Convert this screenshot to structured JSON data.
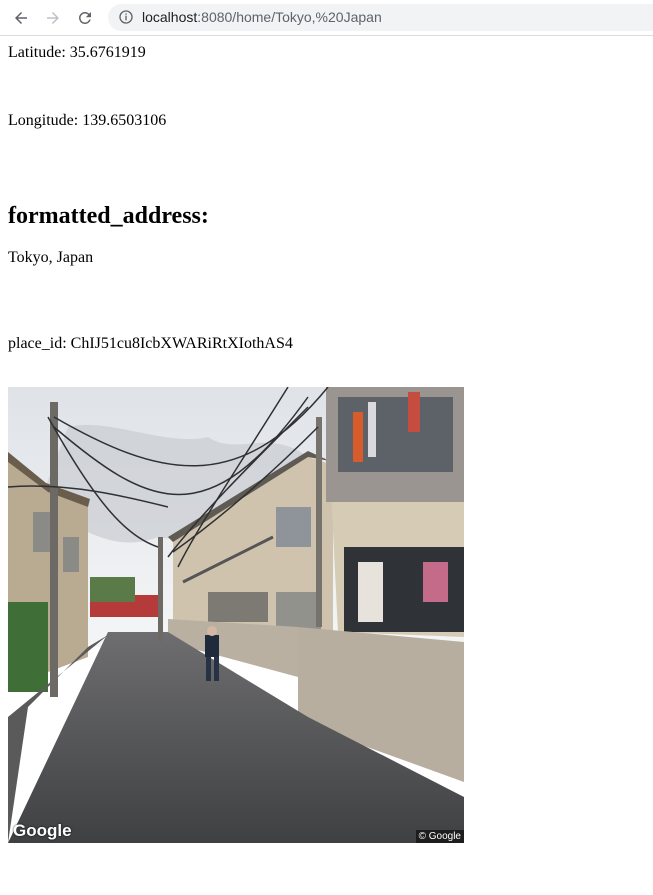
{
  "browser": {
    "url_host": "localhost",
    "url_rest": ":8080/home/Tokyo,%20Japan"
  },
  "page": {
    "latitude_text": "Latitude: 35.6761919",
    "longitude_text": "Longitude: 139.6503106",
    "formatted_address_heading": "formatted_address:",
    "formatted_address_value": "Tokyo, Japan",
    "place_id_text": "place_id: ChIJ51cu8IcbXWARiRtXIothAS4"
  },
  "streetview": {
    "logo_text": "Google",
    "copyright_text": "© Google"
  }
}
